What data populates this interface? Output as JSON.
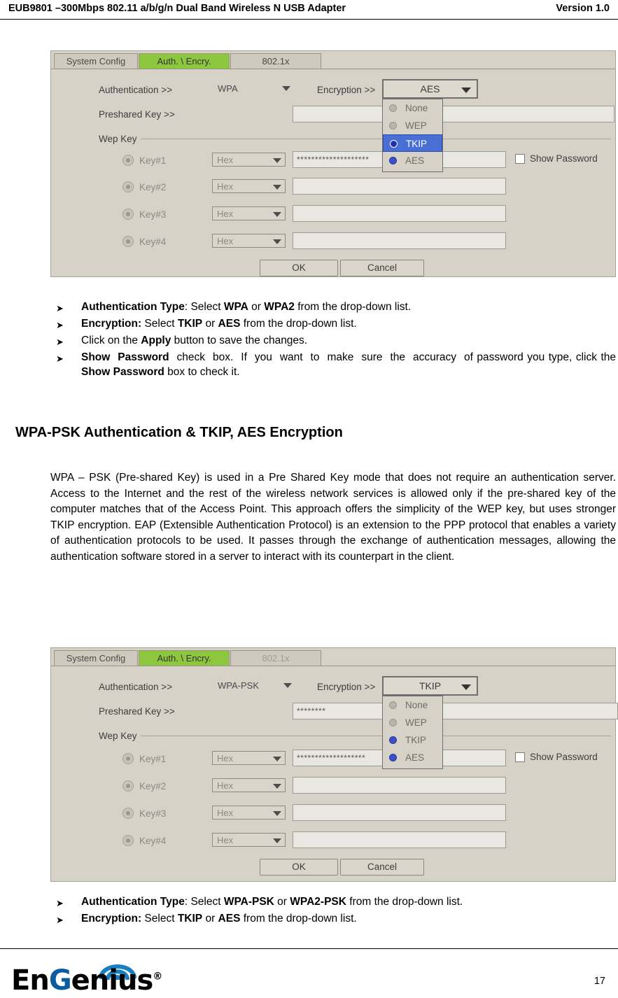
{
  "header": {
    "title": "EUB9801 –300Mbps 802.11 a/b/g/n Dual Band Wireless N USB Adapter",
    "version": "Version 1.0"
  },
  "footer": {
    "logo_en": "En",
    "logo_g": "G",
    "logo_rest": "enius",
    "logo_reg": "®",
    "page_number": "17"
  },
  "screenshot1": {
    "tabs": [
      {
        "label": "System Config",
        "state": "normal"
      },
      {
        "label": "Auth. \\ Encry.",
        "state": "active"
      },
      {
        "label": "802.1x",
        "state": "normal"
      }
    ],
    "auth_label": "Authentication >>",
    "auth_value": "WPA",
    "encryption_label": "Encryption >>",
    "encryption_value": "AES",
    "dropdown_options": [
      {
        "label": "None",
        "selected": false,
        "radio": false
      },
      {
        "label": "WEP",
        "selected": false,
        "radio": false
      },
      {
        "label": "TKIP",
        "selected": true,
        "radio": true
      },
      {
        "label": "AES",
        "selected": false,
        "radio": true
      }
    ],
    "preshared_label": "Preshared Key >>",
    "preshared_value": "",
    "wep_key_label": "Wep Key",
    "keys": [
      {
        "name": "Key#1",
        "format": "Hex",
        "value": "********************"
      },
      {
        "name": "Key#2",
        "format": "Hex",
        "value": ""
      },
      {
        "name": "Key#3",
        "format": "Hex",
        "value": ""
      },
      {
        "name": "Key#4",
        "format": "Hex",
        "value": ""
      }
    ],
    "show_password_label": "Show Password",
    "ok_label": "OK",
    "cancel_label": "Cancel"
  },
  "bullets1": [
    {
      "parts": [
        {
          "t": "Authentication Type",
          "b": true
        },
        {
          "t": ": Select ",
          "b": false
        },
        {
          "t": "WPA",
          "b": true
        },
        {
          "t": " or ",
          "b": false
        },
        {
          "t": "WPA2",
          "b": true
        },
        {
          "t": " from the drop-down list.",
          "b": false
        }
      ]
    },
    {
      "parts": [
        {
          "t": "Encryption:",
          "b": true
        },
        {
          "t": " Select ",
          "b": false
        },
        {
          "t": "TKIP",
          "b": true
        },
        {
          "t": " or ",
          "b": false
        },
        {
          "t": "AES",
          "b": true
        },
        {
          "t": " from the drop-down list.",
          "b": false
        }
      ]
    },
    {
      "parts": [
        {
          "t": "Click on the ",
          "b": false
        },
        {
          "t": "Apply",
          "b": true
        },
        {
          "t": " button to save the changes.",
          "b": false
        }
      ]
    },
    {
      "parts": [
        {
          "t": "Show  Password",
          "b": true
        },
        {
          "t": "  check  box.  If  you  want  to  make  sure  the  accuracy  of password you type, click the ",
          "b": false
        },
        {
          "t": "Show Password",
          "b": true
        },
        {
          "t": " box to check it.",
          "b": false
        }
      ]
    }
  ],
  "section_title": "WPA-PSK Authentication & TKIP, AES Encryption",
  "paragraph": "WPA – PSK (Pre-shared Key) is used in a Pre Shared Key mode that does not require  an  authentication  server.    Access  to  the  Internet  and  the  rest  of  the wireless network services is allowed only if the pre-shared key of the computer matches that of the Access Point.  This approach offers the simplicity of the WEP key, but uses stronger TKIP encryption. EAP (Extensible Authentication Protocol) is  an  extension  to  the  PPP  protocol  that  enables  a  variety  of  authentication protocols to be used. It passes through the exchange of authentication messages, allowing  the  authentication  software  stored  in  a  server  to  interact  with  its counterpart in the client.",
  "screenshot2": {
    "tabs": [
      {
        "label": "System Config",
        "state": "normal"
      },
      {
        "label": "Auth. \\ Encry.",
        "state": "active"
      },
      {
        "label": "802.1x",
        "state": "dim"
      }
    ],
    "auth_label": "Authentication >>",
    "auth_value": "WPA-PSK",
    "encryption_label": "Encryption >>",
    "encryption_value": "TKIP",
    "dropdown_options": [
      {
        "label": "None",
        "selected": false,
        "radio": false
      },
      {
        "label": "WEP",
        "selected": false,
        "radio": false
      },
      {
        "label": "TKIP",
        "selected": false,
        "radio": true
      },
      {
        "label": "AES",
        "selected": false,
        "radio": true
      }
    ],
    "preshared_label": "Preshared Key >>",
    "preshared_value": "********",
    "wep_key_label": "Wep Key",
    "keys": [
      {
        "name": "Key#1",
        "format": "Hex",
        "value": "*******************"
      },
      {
        "name": "Key#2",
        "format": "Hex",
        "value": ""
      },
      {
        "name": "Key#3",
        "format": "Hex",
        "value": ""
      },
      {
        "name": "Key#4",
        "format": "Hex",
        "value": ""
      }
    ],
    "show_password_label": "Show Password",
    "ok_label": "OK",
    "cancel_label": "Cancel"
  },
  "bullets2": [
    {
      "parts": [
        {
          "t": "Authentication Type",
          "b": true
        },
        {
          "t": ": Select ",
          "b": false
        },
        {
          "t": "WPA-PSK",
          "b": true
        },
        {
          "t": " or ",
          "b": false
        },
        {
          "t": "WPA2-PSK",
          "b": true
        },
        {
          "t": " from the drop-down list.",
          "b": false
        }
      ]
    },
    {
      "parts": [
        {
          "t": "Encryption:",
          "b": true
        },
        {
          "t": " Select ",
          "b": false
        },
        {
          "t": "TKIP",
          "b": true
        },
        {
          "t": " or ",
          "b": false
        },
        {
          "t": "AES",
          "b": true
        },
        {
          "t": " from the drop-down list.",
          "b": false
        }
      ]
    }
  ]
}
